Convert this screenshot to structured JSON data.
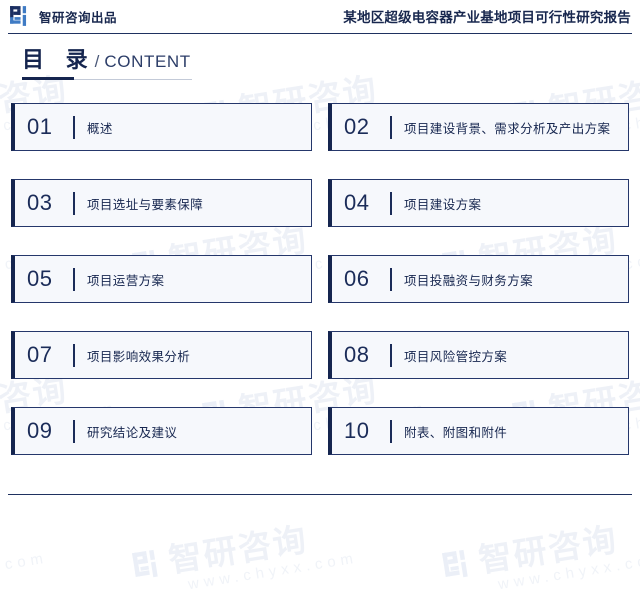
{
  "header": {
    "brand_name": "智研咨询出品",
    "brand_logo_icon": "zhiyan-logo-icon",
    "report_title": "某地区超级电容器产业基地项目可行性研究报告"
  },
  "page_title": {
    "cn": "目 录",
    "separator": "/",
    "en": "CONTENT"
  },
  "toc": {
    "items": [
      {
        "number": "01",
        "label": "概述"
      },
      {
        "number": "02",
        "label": "项目建设背景、需求分析及产出方案"
      },
      {
        "number": "03",
        "label": "项目选址与要素保障"
      },
      {
        "number": "04",
        "label": "项目建设方案"
      },
      {
        "number": "05",
        "label": "项目运营方案"
      },
      {
        "number": "06",
        "label": "项目投融资与财务方案"
      },
      {
        "number": "07",
        "label": "项目影响效果分析"
      },
      {
        "number": "08",
        "label": "项目风险管控方案"
      },
      {
        "number": "09",
        "label": "研究结论及建议"
      },
      {
        "number": "10",
        "label": "附表、附图和附件"
      }
    ]
  },
  "watermark": {
    "name": "智研咨询",
    "url": "www.chyxx.com",
    "logo_icon": "zhiyan-logo-icon"
  },
  "colors": {
    "navy": "#15254f",
    "border": "#25376b",
    "box_fill": "#f6f8fc",
    "logo_dark": "#1b2f62",
    "logo_light": "#3f7bc4",
    "watermark": "#eef1f7"
  }
}
